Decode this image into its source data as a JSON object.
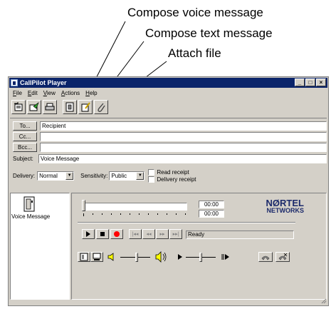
{
  "callouts": {
    "compose_voice": "Compose voice message",
    "compose_text": "Compose text message",
    "attach_file": "Attach file"
  },
  "window": {
    "title": "CallPilot Player",
    "controls": {
      "minimize": "_",
      "maximize": "□",
      "close": "×"
    }
  },
  "menu": {
    "file": {
      "key": "F",
      "rest": "ile"
    },
    "edit": {
      "key": "E",
      "rest": "dit"
    },
    "view": {
      "key": "V",
      "rest": "iew"
    },
    "actions": {
      "key": "A",
      "rest": "ctions"
    },
    "help": {
      "key": "H",
      "rest": "elp"
    }
  },
  "toolbar": {
    "icons": [
      "reply-icon",
      "send-icon",
      "print-icon",
      "compose-voice-icon",
      "compose-text-icon",
      "attach-file-icon"
    ]
  },
  "header": {
    "to_label": "To...",
    "to_value": "Recipient",
    "cc_label": "Cc...",
    "cc_value": "",
    "bcc_label": "Bcc...",
    "bcc_value": "",
    "subject_label": "Subject:",
    "subject_value": "Voice Message",
    "delivery_label": "Delivery:",
    "delivery_value": "Normal",
    "sensitivity_label": "Sensitivity:",
    "sensitivity_value": "Public",
    "read_receipt": "Read receipt",
    "delivery_receipt": "Delivery receipt"
  },
  "attachments": {
    "item_label": "Voice Message"
  },
  "player": {
    "time_position": "00:00",
    "time_length": "00:00",
    "status": "Ready",
    "logo_top": "NØRTEL",
    "logo_bottom": "NETWORKS",
    "position_fraction": 0,
    "volume_fraction": 0.55,
    "speed_fraction": 0.5,
    "record_color": "#ff0000",
    "logo_color": "#1c2a6b"
  }
}
